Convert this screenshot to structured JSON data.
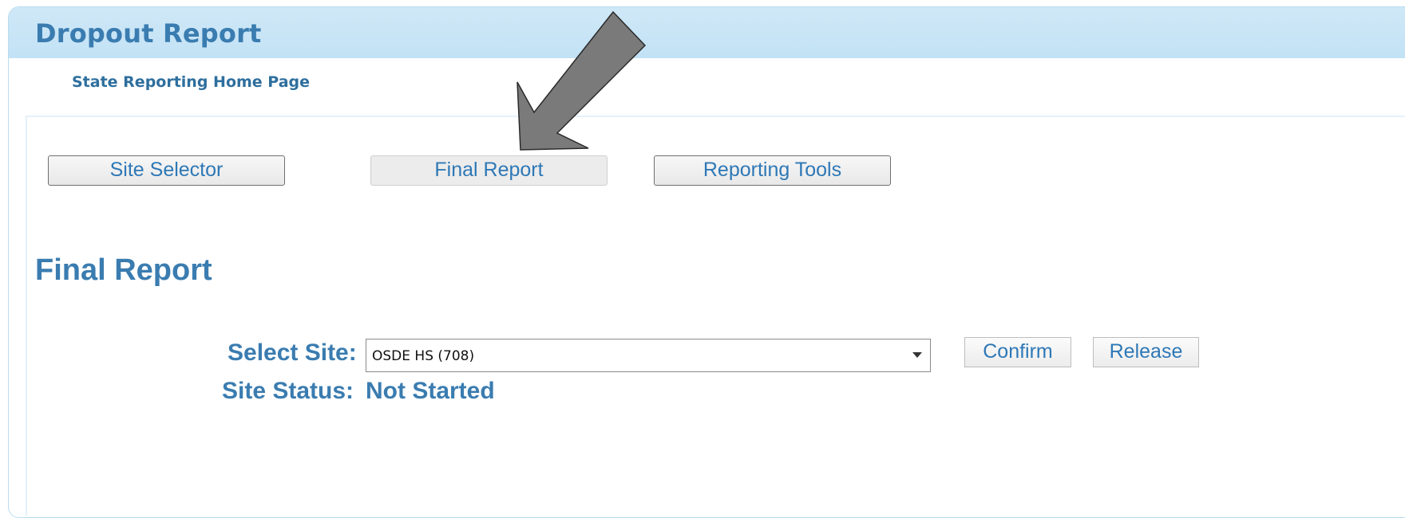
{
  "window": {
    "title": "Dropout Report"
  },
  "nav": {
    "home_link": "State Reporting Home Page",
    "buttons": [
      {
        "label": "Site Selector",
        "selected": false
      },
      {
        "label": "Final Report",
        "selected": true
      },
      {
        "label": "Reporting Tools",
        "selected": false
      }
    ]
  },
  "main": {
    "section_title": "Final Report",
    "select_site_label": "Select Site:",
    "select_site_value": "OSDE HS (708)",
    "site_status_label": "Site Status:",
    "site_status_value": "Not Started",
    "confirm_label": "Confirm",
    "release_label": "Release"
  },
  "annotation": {
    "arrow_icon": "arrow-down-left-icon",
    "arrow_color": "#7a7a7a"
  },
  "colors": {
    "header_bg": "#c6e4f6",
    "accent_text": "#3a7cb0",
    "button_text": "#2e78b6"
  }
}
